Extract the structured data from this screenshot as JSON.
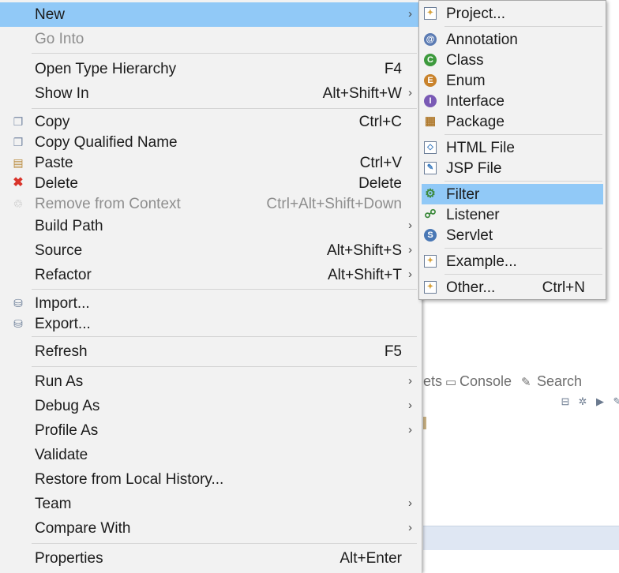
{
  "menu": {
    "items": [
      {
        "label": "New",
        "has_submenu": true,
        "highlighted": true
      },
      {
        "label": "Go Into",
        "disabled": true
      },
      {
        "label": "Open Type Hierarchy",
        "shortcut": "F4"
      },
      {
        "label": "Show In",
        "shortcut": "Alt+Shift+W",
        "has_submenu": true
      },
      {
        "label": "Copy",
        "shortcut": "Ctrl+C",
        "icon": "copy-icon"
      },
      {
        "label": "Copy Qualified Name",
        "icon": "copy-qualified-name-icon"
      },
      {
        "label": "Paste",
        "shortcut": "Ctrl+V",
        "icon": "paste-icon"
      },
      {
        "label": "Delete",
        "shortcut": "Delete",
        "icon": "delete-icon"
      },
      {
        "label": "Remove from Context",
        "shortcut": "Ctrl+Alt+Shift+Down",
        "disabled": true,
        "icon": "remove-from-context-icon"
      },
      {
        "label": "Build Path",
        "has_submenu": true
      },
      {
        "label": "Source",
        "shortcut": "Alt+Shift+S",
        "has_submenu": true
      },
      {
        "label": "Refactor",
        "shortcut": "Alt+Shift+T",
        "has_submenu": true
      },
      {
        "label": "Import...",
        "icon": "import-icon"
      },
      {
        "label": "Export...",
        "icon": "export-icon"
      },
      {
        "label": "Refresh",
        "shortcut": "F5"
      },
      {
        "label": "Run As",
        "has_submenu": true
      },
      {
        "label": "Debug As",
        "has_submenu": true
      },
      {
        "label": "Profile As",
        "has_submenu": true
      },
      {
        "label": "Validate"
      },
      {
        "label": "Restore from Local History..."
      },
      {
        "label": "Team",
        "has_submenu": true
      },
      {
        "label": "Compare With",
        "has_submenu": true
      },
      {
        "label": "Properties",
        "shortcut": "Alt+Enter"
      }
    ],
    "submenu_arrow": "›"
  },
  "submenu_new": {
    "items": [
      {
        "label": "Project...",
        "icon": "new-project-icon"
      },
      {
        "label": "Annotation",
        "icon": "annotation-icon",
        "glyph": "@"
      },
      {
        "label": "Class",
        "icon": "class-icon",
        "glyph": "C"
      },
      {
        "label": "Enum",
        "icon": "enum-icon",
        "glyph": "E"
      },
      {
        "label": "Interface",
        "icon": "interface-icon",
        "glyph": "I"
      },
      {
        "label": "Package",
        "icon": "package-icon"
      },
      {
        "label": "HTML File",
        "icon": "html-file-icon"
      },
      {
        "label": "JSP File",
        "icon": "jsp-file-icon"
      },
      {
        "label": "Filter",
        "icon": "filter-icon",
        "highlighted": true
      },
      {
        "label": "Listener",
        "icon": "listener-icon"
      },
      {
        "label": "Servlet",
        "icon": "servlet-icon"
      },
      {
        "label": "Example...",
        "icon": "example-icon"
      },
      {
        "label": "Other...",
        "shortcut": "Ctrl+N",
        "icon": "other-wizard-icon"
      }
    ]
  },
  "background": {
    "tab_partial": "ets",
    "tab_console": "Console",
    "tab_search": "Search"
  },
  "colors": {
    "highlight": "#91c9f7",
    "menu_bg": "#f2f2f2",
    "delete_red": "#d9342b",
    "class_green": "#3d9a3d",
    "enum_orange": "#c9822b",
    "interface_purple": "#7a5ab5",
    "annotation_blue": "#5b7bb3"
  }
}
